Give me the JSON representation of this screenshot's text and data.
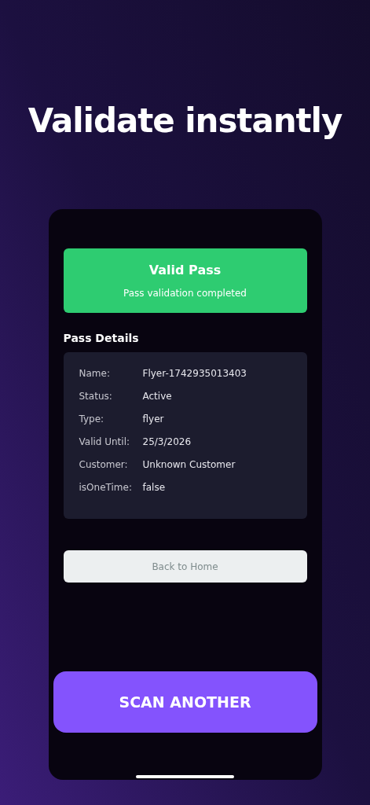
{
  "headline": "Validate instantly",
  "result": {
    "title": "Valid Pass",
    "subtitle": "Pass validation completed",
    "valid": true
  },
  "details": {
    "title": "Pass Details",
    "rows": [
      {
        "label": "Name:",
        "value": "Flyer-1742935013403"
      },
      {
        "label": "Status:",
        "value": "Active"
      },
      {
        "label": "Type:",
        "value": "flyer"
      },
      {
        "label": "Valid Until:",
        "value": "25/3/2026"
      },
      {
        "label": "Customer:",
        "value": "Unknown Customer"
      },
      {
        "label": "isOneTime:",
        "value": "false"
      }
    ]
  },
  "back_button": "Back to Home",
  "scan_button": "SCAN ANOTHER"
}
